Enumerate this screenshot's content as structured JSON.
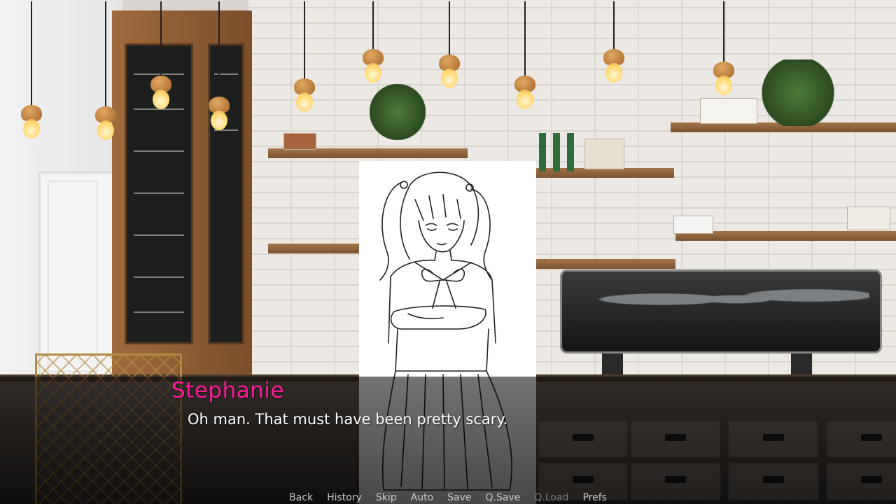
{
  "dialogue": {
    "speaker": "Stephanie",
    "line": "Oh man. That must have been pretty scary."
  },
  "quick_menu": {
    "items": [
      {
        "label": "Back",
        "enabled": true
      },
      {
        "label": "History",
        "enabled": true
      },
      {
        "label": "Skip",
        "enabled": true
      },
      {
        "label": "Auto",
        "enabled": true
      },
      {
        "label": "Save",
        "enabled": true
      },
      {
        "label": "Q.Save",
        "enabled": true
      },
      {
        "label": "Q.Load",
        "enabled": false
      },
      {
        "label": "Prefs",
        "enabled": true
      }
    ]
  },
  "colors": {
    "speaker_name": "#ff1a9a",
    "dialogue_text": "#ffffff",
    "menu_text": "#c8c8c8",
    "menu_disabled": "#7a7a7a"
  }
}
